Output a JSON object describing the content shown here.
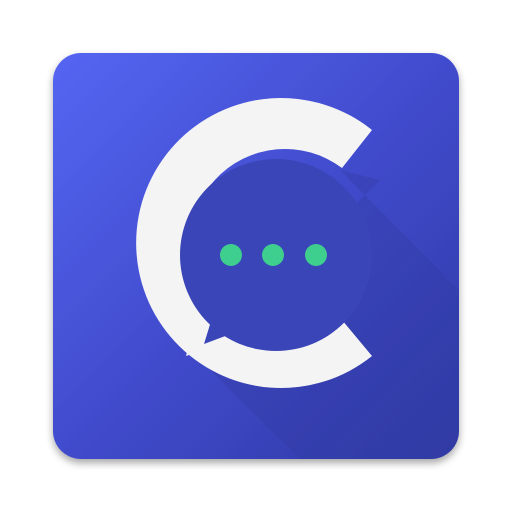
{
  "app_icon": {
    "name": "chat-app-icon",
    "icon_semantic": "letter-c-with-speech-bubble-icon",
    "colors": {
      "tile_gradient_start": "#5566f2",
      "tile_gradient_mid": "#3f49c9",
      "tile_gradient_end": "#2f3aa3",
      "letter_c": "#f4f4f4",
      "bubble_fill": "#3a45b7",
      "typing_dots": "#3ecf8e"
    },
    "typing_dots_count": 3
  }
}
